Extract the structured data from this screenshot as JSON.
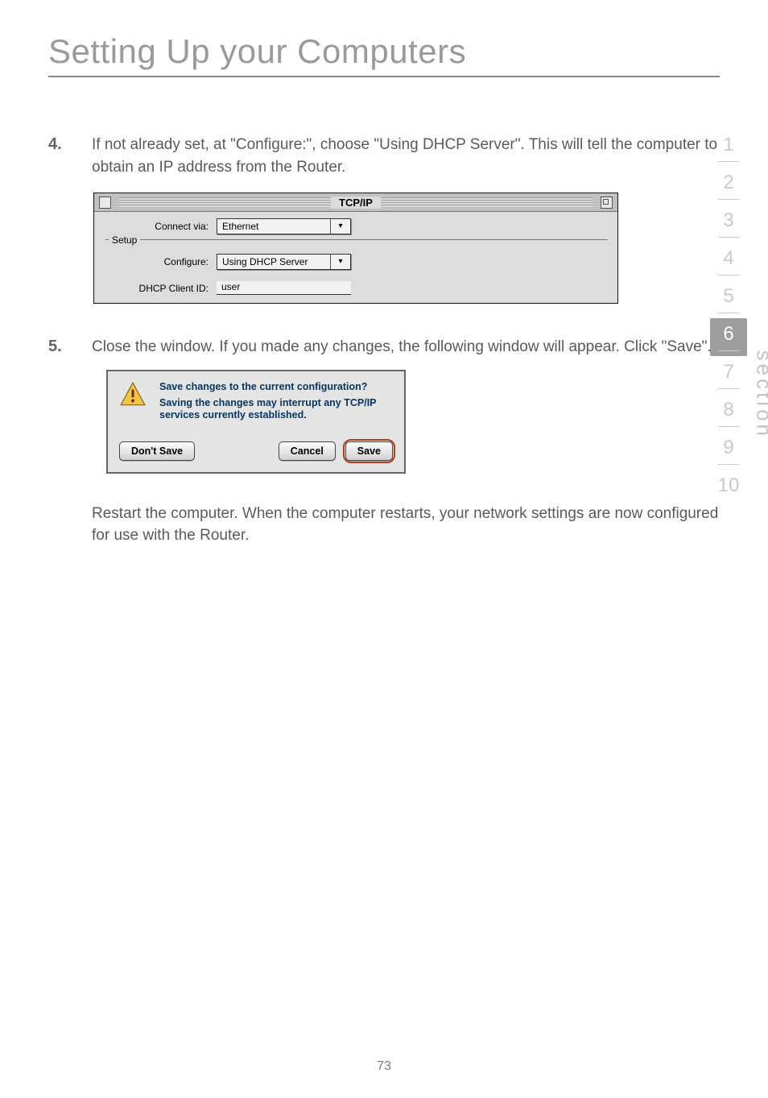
{
  "header": {
    "title": "Setting Up your Computers"
  },
  "steps": {
    "s4": {
      "num": "4.",
      "text": "If not already set, at \"Configure:\", choose \"Using DHCP Server\". This will tell the computer to obtain an IP address from the Router."
    },
    "s5": {
      "num": "5.",
      "text": "Close the window. If you made any changes, the following window will appear. Click \"Save\"."
    },
    "closing": "Restart the computer. When the computer restarts, your network settings are now configured for use with the Router."
  },
  "tcpip": {
    "title": "TCP/IP",
    "connect_via_label": "Connect via:",
    "connect_via_value": "Ethernet",
    "setup_label": "Setup",
    "configure_label": "Configure:",
    "configure_value": "Using DHCP Server",
    "dhcp_client_label": "DHCP Client ID:",
    "dhcp_client_value": "user"
  },
  "dialog": {
    "heading": "Save changes to the current configuration?",
    "message": "Saving the changes may interrupt any TCP/IP services currently established.",
    "dont_save": "Don't Save",
    "cancel": "Cancel",
    "save": "Save"
  },
  "nav": {
    "items": [
      "1",
      "2",
      "3",
      "4",
      "5",
      "6",
      "7",
      "8",
      "9",
      "10"
    ],
    "active_index": 5,
    "word": "section"
  },
  "page_number": "73"
}
